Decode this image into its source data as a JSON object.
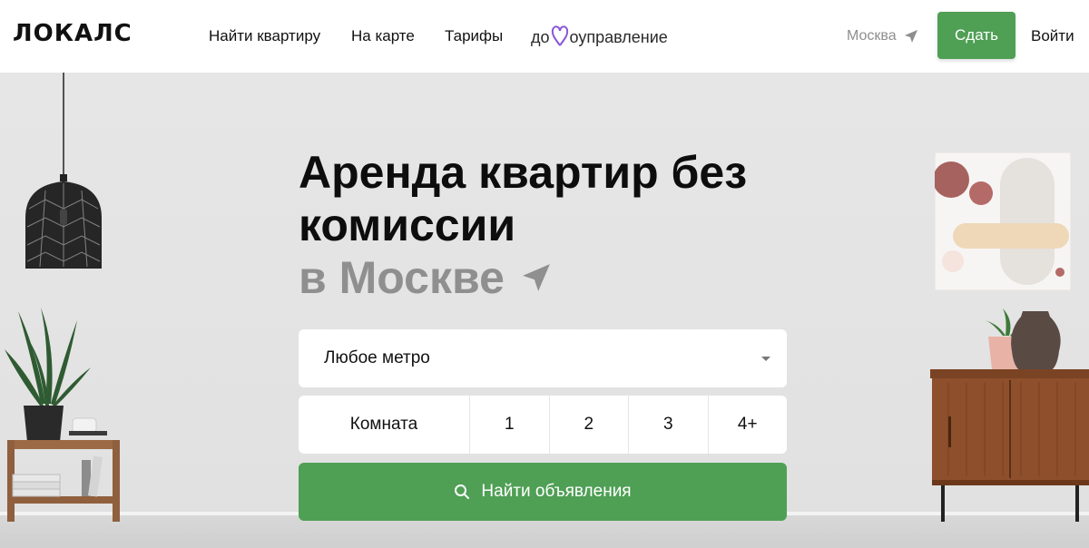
{
  "header": {
    "logo": "ЛОКАЛС",
    "nav": [
      "Найти квартиру",
      "На карте",
      "Тарифы"
    ],
    "domo_left": "до",
    "domo_right": "оуправление",
    "city": "Москва",
    "rent_button": "Сдать",
    "login": "Войти"
  },
  "hero": {
    "title_line1": "Аренда квартир без",
    "title_line2": "комиссии",
    "title_city": "в Москве",
    "metro_placeholder": "Любое метро",
    "rooms": [
      "Комната",
      "1",
      "2",
      "3",
      "4+"
    ],
    "search_button": "Найти объявления"
  },
  "colors": {
    "accent_green": "#4f9f55",
    "heart_purple": "#8a55d6",
    "muted_gray": "#8f8f8f"
  },
  "icons": {
    "city_arrow": "location-arrow-icon",
    "search": "search-icon",
    "dropdown": "chevron-down-icon"
  }
}
